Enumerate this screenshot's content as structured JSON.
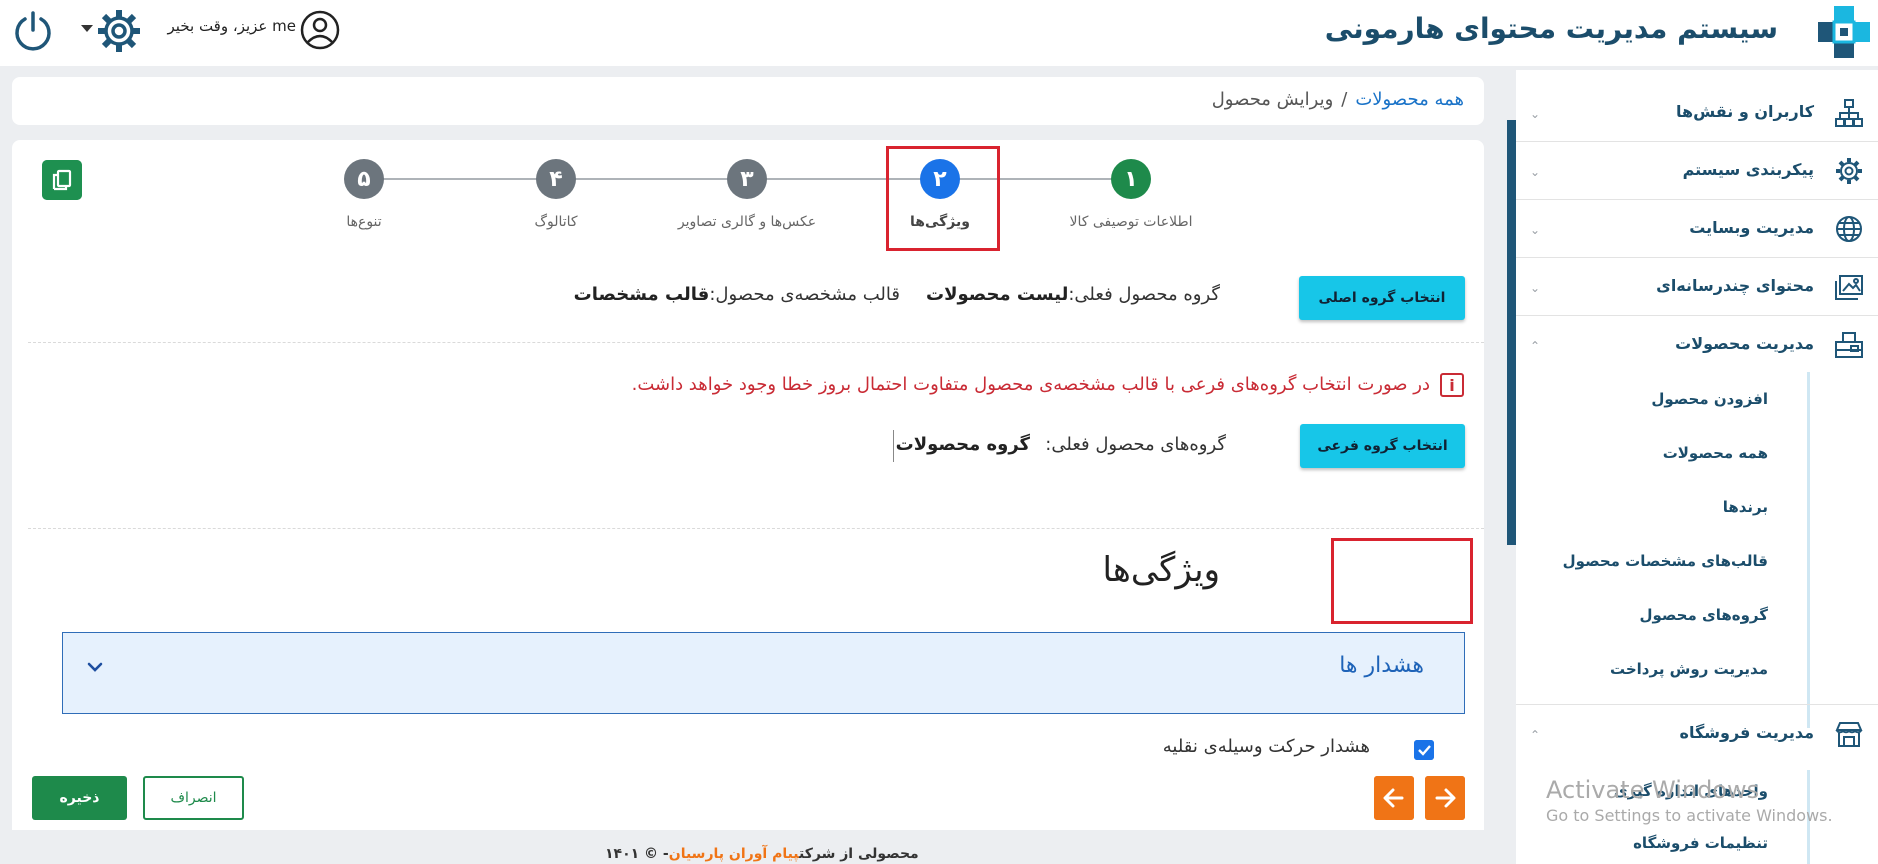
{
  "header": {
    "app_title": "سیستم مدیریت محتوای هارمونی",
    "greeting": "me عزیز، وقت بخیر"
  },
  "sidebar": {
    "items": [
      {
        "label": "کاربران و نقش‌ها",
        "icon": "sitemap-icon"
      },
      {
        "label": "پیکربندی سیستم",
        "icon": "gear-icon"
      },
      {
        "label": "مدیریت وبسایت",
        "icon": "globe-icon"
      },
      {
        "label": "محتوای چندرسانه‌ای",
        "icon": "images-icon"
      },
      {
        "label": "مدیریت محصولات",
        "icon": "products-icon"
      },
      {
        "label": "مدیریت فروشگاه",
        "icon": "store-icon"
      }
    ],
    "products_sub": [
      "افزودن محصول",
      "همه محصولات",
      "برندها",
      "قالب‌های مشخصات محصول",
      "گروه‌های محصول",
      "مدیریت روش پرداخت"
    ],
    "store_sub": [
      "واحدهای اندازه گیری",
      "تنظیمات فروشگاه"
    ]
  },
  "breadcrumb": {
    "parent": "همه محصولات",
    "separator": "/",
    "current": "ویرایش محصول"
  },
  "steps": [
    {
      "number": "۱",
      "label": "اطلاعات توصیفی کالا",
      "state": "done"
    },
    {
      "number": "۲",
      "label": "ویژگی‌ها",
      "state": "active"
    },
    {
      "number": "۳",
      "label": "عکس‌ها و گالری تصاویر",
      "state": "pending"
    },
    {
      "number": "۴",
      "label": "کاتالوگ",
      "state": "pending"
    },
    {
      "number": "۵",
      "label": "تنوع‌ها",
      "state": "pending"
    }
  ],
  "main_group": {
    "button_label": "انتخاب گروه اصلی",
    "current_group_label": "گروه محصول فعلی:",
    "current_group_value": "لیست محصولات",
    "spec_template_label": "قالب مشخصه‌ی محصول:",
    "spec_template_value": "قالب مشخصات"
  },
  "warning": {
    "text": "در صورت انتخاب گروه‌های فرعی با قالب مشخصه‌ی محصول متفاوت احتمال بروز خطا وجود خواهد داشت."
  },
  "sub_group": {
    "button_label": "انتخاب گروه فرعی",
    "current_groups_label": "گروه‌های محصول فعلی:",
    "current_groups_value": "گروه محصولات"
  },
  "features": {
    "title": "ویژگی‌ها",
    "accordion_title": "هشدار ها",
    "checkbox_label": "هشدار حرکت وسیله‌ی نقلیه",
    "checkbox_checked": true
  },
  "footer": {
    "save_label": "ذخیره",
    "cancel_label": "انصراف",
    "copyright_prefix": "محصولی از شرکت",
    "copyright_brand": "پیام آوران پارسیان",
    "copyright_suffix": "- © ۱۴۰۱"
  },
  "watermark": {
    "line1": "Activate Windows",
    "line2": "Go to Settings to activate Windows."
  },
  "colors": {
    "done_step": "#1e8a4b",
    "active_step": "#1a73e8",
    "pending_step": "#6c757d",
    "accent_cyan": "#17c6e8",
    "nav_orange": "#f07416",
    "highlight_red": "#d9232f"
  }
}
